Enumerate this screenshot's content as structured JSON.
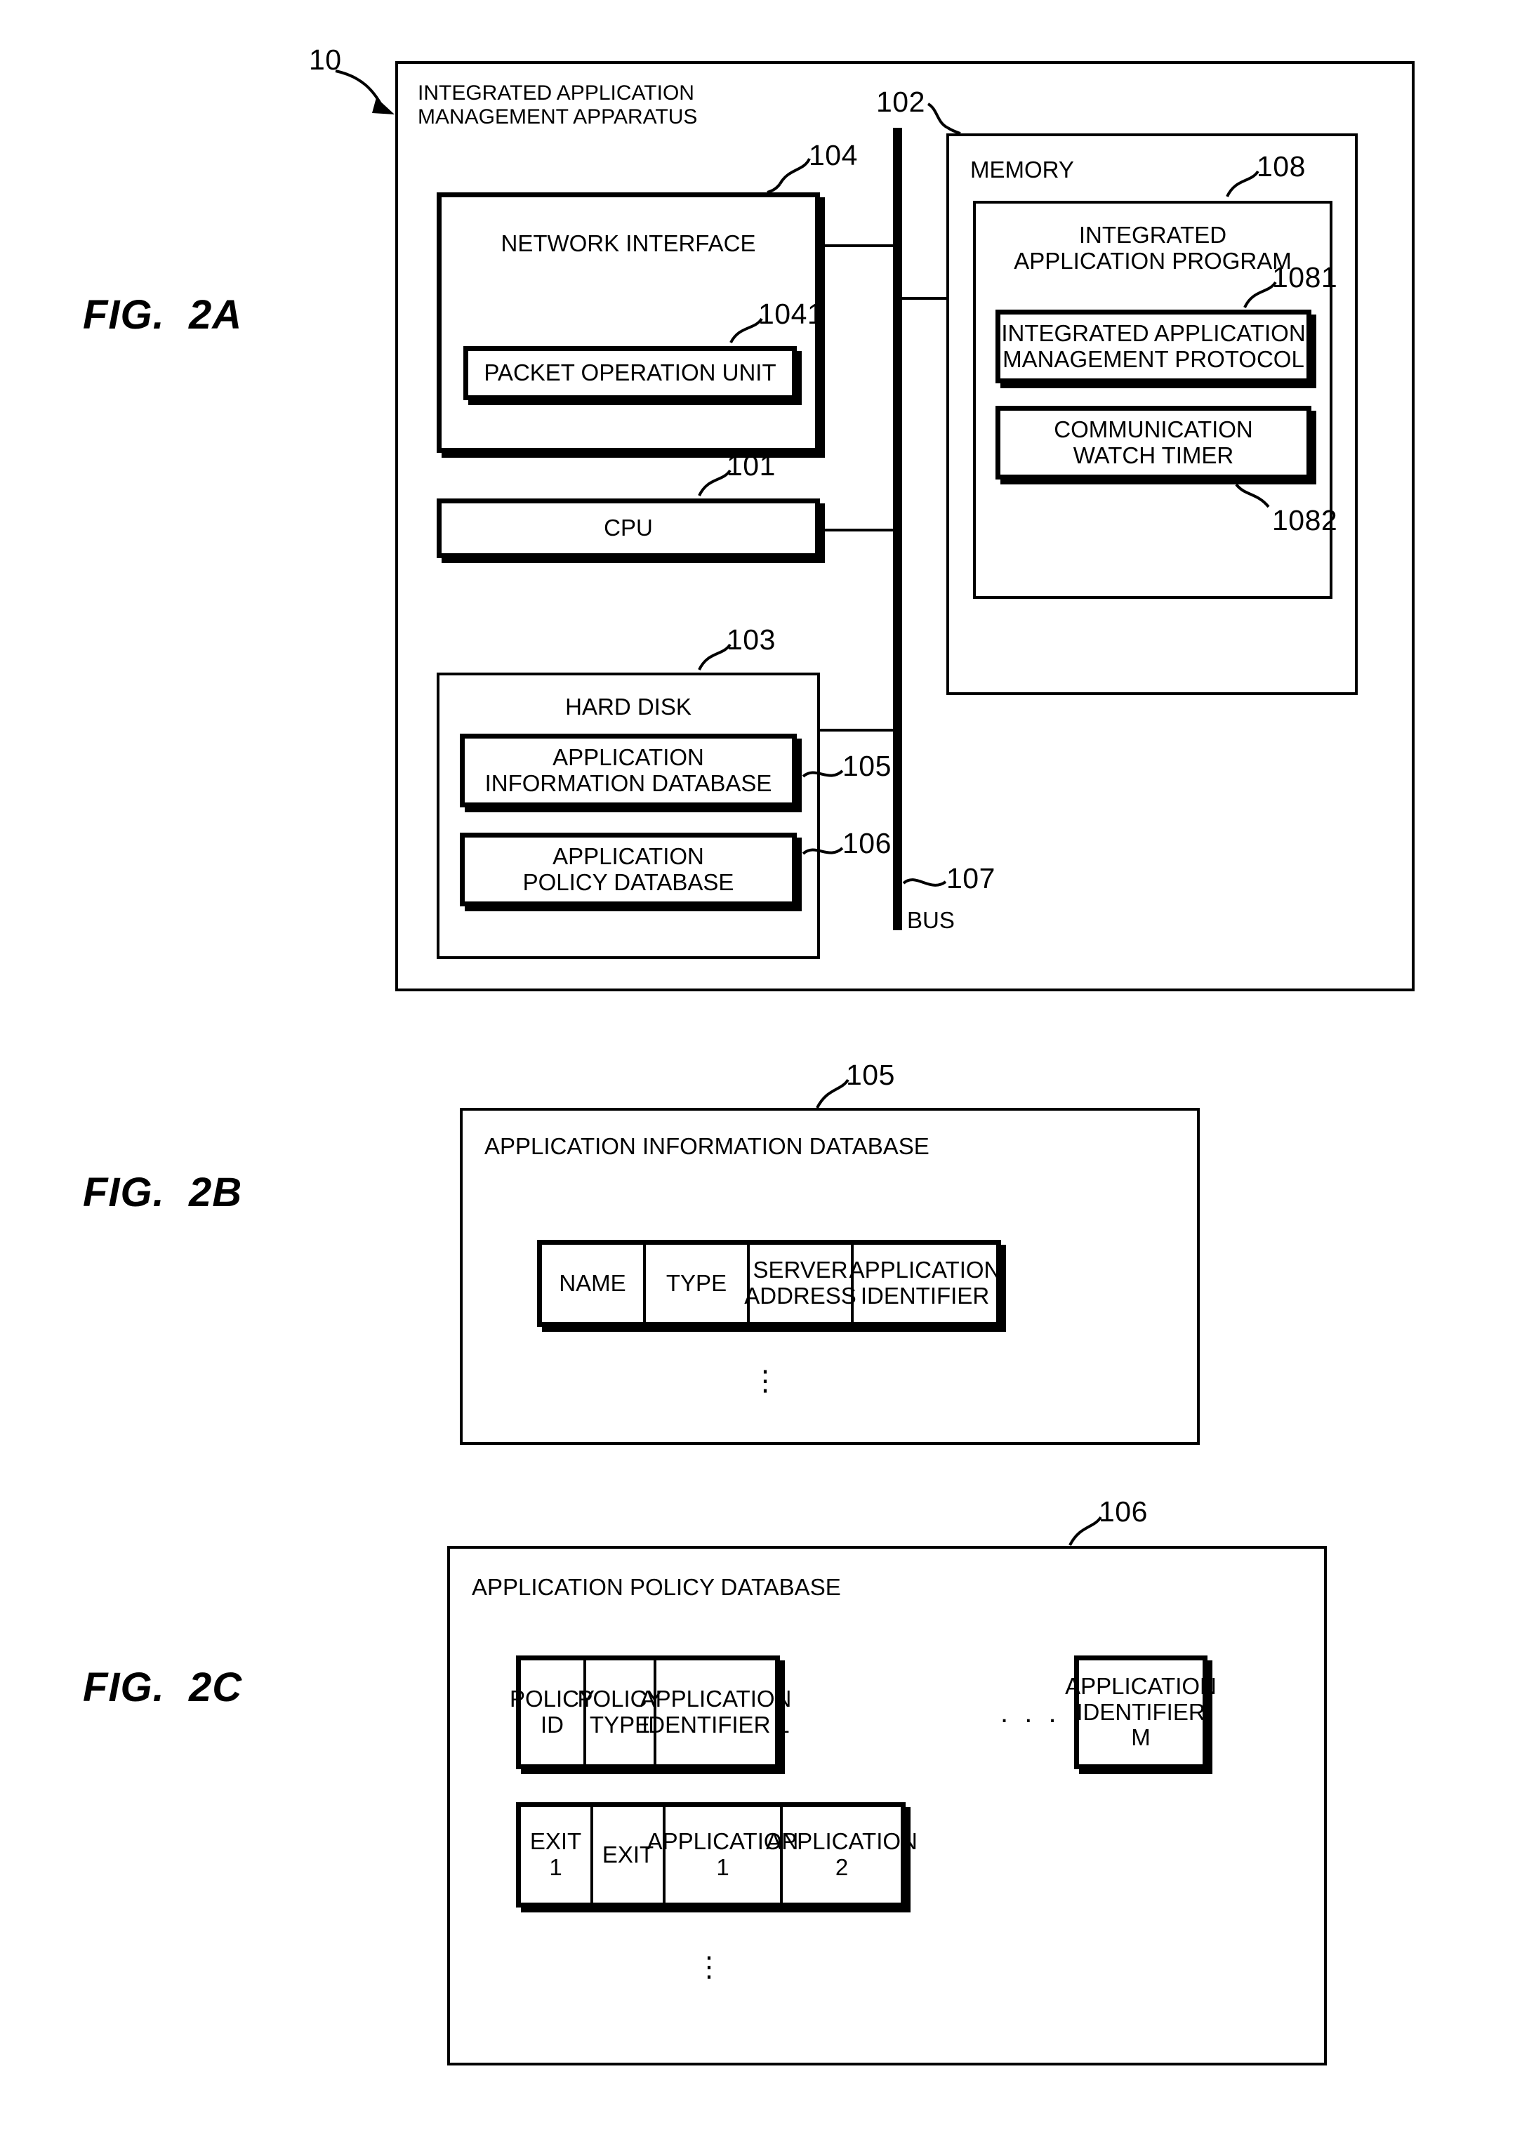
{
  "figures": {
    "a": {
      "caption": "FIG.  2A",
      "ref": "10",
      "apparatus_title": "INTEGRATED APPLICATION\nMANAGEMENT APPARATUS",
      "network_interface": {
        "label": "NETWORK INTERFACE",
        "ref": "104"
      },
      "packet_operation_unit": {
        "label": "PACKET OPERATION UNIT",
        "ref": "1041"
      },
      "cpu": {
        "label": "CPU",
        "ref": "101"
      },
      "hard_disk": {
        "label": "HARD DISK",
        "ref": "103"
      },
      "application_information_database": {
        "label": "APPLICATION\nINFORMATION DATABASE",
        "ref": "105"
      },
      "application_policy_database": {
        "label": "APPLICATION\nPOLICY DATABASE",
        "ref": "106"
      },
      "bus": {
        "label": "BUS",
        "ref": "107"
      },
      "memory": {
        "label": "MEMORY",
        "ref": "102"
      },
      "integrated_application_program": {
        "label": "INTEGRATED\nAPPLICATION PROGRAM",
        "ref": "108"
      },
      "integrated_application_management_protocol": {
        "label": "INTEGRATED APPLICATION\nMANAGEMENT PROTOCOL",
        "ref": "1081"
      },
      "communication_watch_timer": {
        "label": "COMMUNICATION\nWATCH TIMER",
        "ref": "1082"
      }
    },
    "b": {
      "caption": "FIG.  2B",
      "ref": "105",
      "title": "APPLICATION INFORMATION DATABASE",
      "columns": [
        "NAME",
        "TYPE",
        "SERVER\nADDRESS",
        "APPLICATION\nIDENTIFIER"
      ],
      "ellipsis": "⋮"
    },
    "c": {
      "caption": "FIG.  2C",
      "ref": "106",
      "title": "APPLICATION POLICY DATABASE",
      "header_row": [
        "POLICY\nID",
        "POLICY\nTYPE",
        "APPLICATION\nIDENTIFIER 1"
      ],
      "header_row_gap": ". . .",
      "header_row_last": "APPLICATION\nIDENTIFIER M",
      "data_row": [
        "EXIT 1",
        "EXIT",
        "APPLICATION\n1",
        "APPLICATION\n2"
      ],
      "ellipsis": "⋮"
    }
  }
}
